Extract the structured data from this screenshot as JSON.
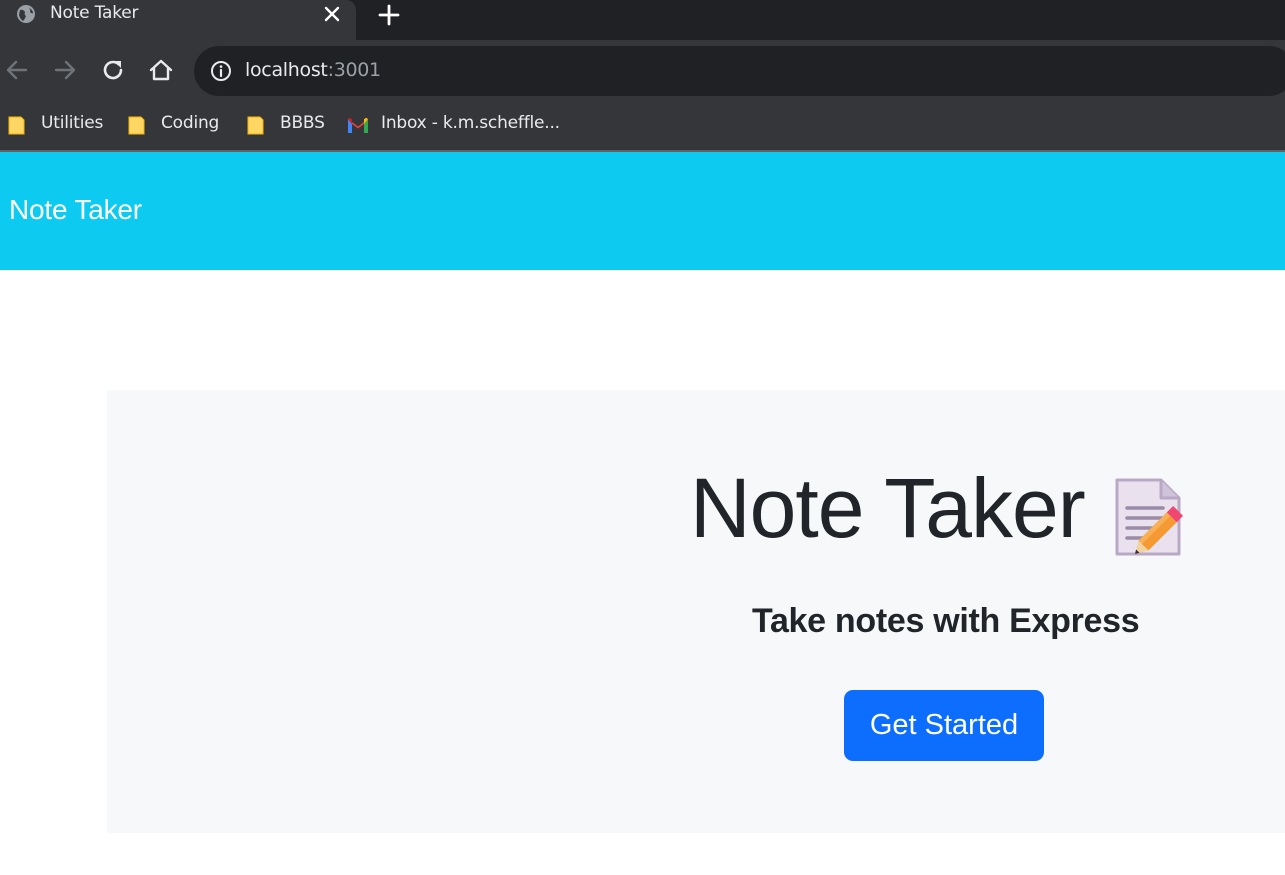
{
  "browser": {
    "tab": {
      "title": "Note Taker"
    },
    "url": {
      "host": "localhost",
      "port": ":3001"
    },
    "bookmarks": [
      {
        "label": "Utilities",
        "icon": "folder-icon"
      },
      {
        "label": "Coding",
        "icon": "folder-icon"
      },
      {
        "label": "BBBS",
        "icon": "folder-icon"
      },
      {
        "label": "Inbox - k.m.scheffle...",
        "icon": "gmail-icon"
      }
    ]
  },
  "page": {
    "navbar": {
      "brand": "Note Taker",
      "color": "#0dcaf0"
    },
    "hero": {
      "title": "Note Taker",
      "icon": "memo-pencil-icon",
      "subtitle": "Take notes with Express",
      "button_label": "Get Started",
      "button_color": "#0d6efd"
    }
  }
}
